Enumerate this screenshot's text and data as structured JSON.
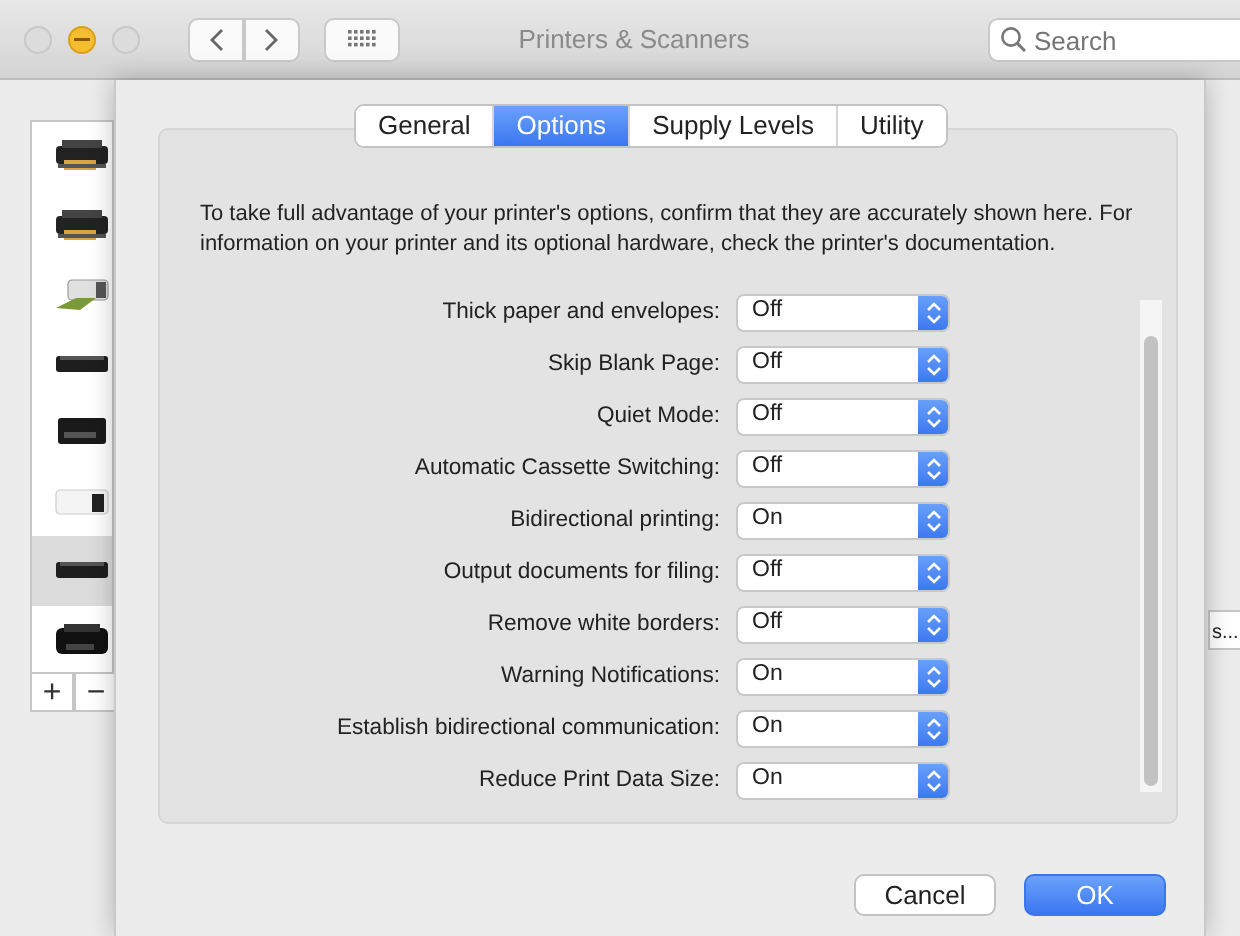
{
  "window": {
    "title": "Printers & Scanners",
    "search": {
      "placeholder": "Search"
    }
  },
  "printers": [
    {
      "kind": "inkjet",
      "selected": false
    },
    {
      "kind": "inkjet",
      "selected": false
    },
    {
      "kind": "photo",
      "selected": false
    },
    {
      "kind": "flat",
      "selected": false
    },
    {
      "kind": "tall",
      "selected": false
    },
    {
      "kind": "white",
      "selected": false
    },
    {
      "kind": "flat",
      "selected": true
    },
    {
      "kind": "large",
      "selected": false
    }
  ],
  "list_buttons": [
    "+",
    "−"
  ],
  "behind_button": {
    "label": "s..."
  },
  "tabs": [
    {
      "label": "General",
      "selected": false
    },
    {
      "label": "Options",
      "selected": true
    },
    {
      "label": "Supply Levels",
      "selected": false
    },
    {
      "label": "Utility",
      "selected": false
    }
  ],
  "description": "To take full advantage of your printer's options, confirm that they are accurately shown here. For information on your printer and its optional hardware, check the printer's documentation.",
  "options": [
    {
      "label": "Thick paper and envelopes:",
      "value": "Off"
    },
    {
      "label": "Skip Blank Page:",
      "value": "Off"
    },
    {
      "label": "Quiet Mode:",
      "value": "Off"
    },
    {
      "label": "Automatic Cassette Switching:",
      "value": "Off"
    },
    {
      "label": "Bidirectional printing:",
      "value": "On"
    },
    {
      "label": "Output documents for filing:",
      "value": "Off"
    },
    {
      "label": "Remove white borders:",
      "value": "Off"
    },
    {
      "label": "Warning Notifications:",
      "value": "On"
    },
    {
      "label": "Establish bidirectional communication:",
      "value": "On"
    },
    {
      "label": "Reduce Print Data Size:",
      "value": "On"
    }
  ],
  "buttons": [
    {
      "label": "Cancel",
      "default": false
    },
    {
      "label": "OK",
      "default": true
    }
  ]
}
